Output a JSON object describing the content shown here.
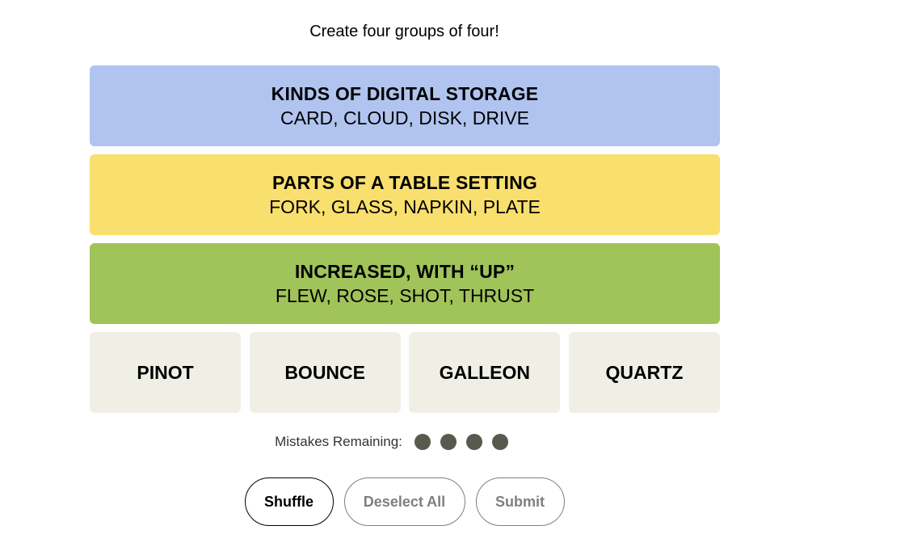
{
  "instructions": "Create four groups of four!",
  "solved_groups": [
    {
      "title": "KINDS OF DIGITAL STORAGE",
      "members": "CARD, CLOUD, DISK, DRIVE",
      "color": "#b0c4ef"
    },
    {
      "title": "PARTS OF A TABLE SETTING",
      "members": "FORK, GLASS, NAPKIN, PLATE",
      "color": "#f9df6d"
    },
    {
      "title": "INCREASED, WITH “UP”",
      "members": "FLEW, ROSE, SHOT, THRUST",
      "color": "#a0c35a"
    }
  ],
  "tiles": [
    "PINOT",
    "BOUNCE",
    "GALLEON",
    "QUARTZ"
  ],
  "mistakes": {
    "label": "Mistakes Remaining:",
    "remaining": 4
  },
  "buttons": {
    "shuffle": "Shuffle",
    "deselect_all": "Deselect All",
    "submit": "Submit"
  }
}
